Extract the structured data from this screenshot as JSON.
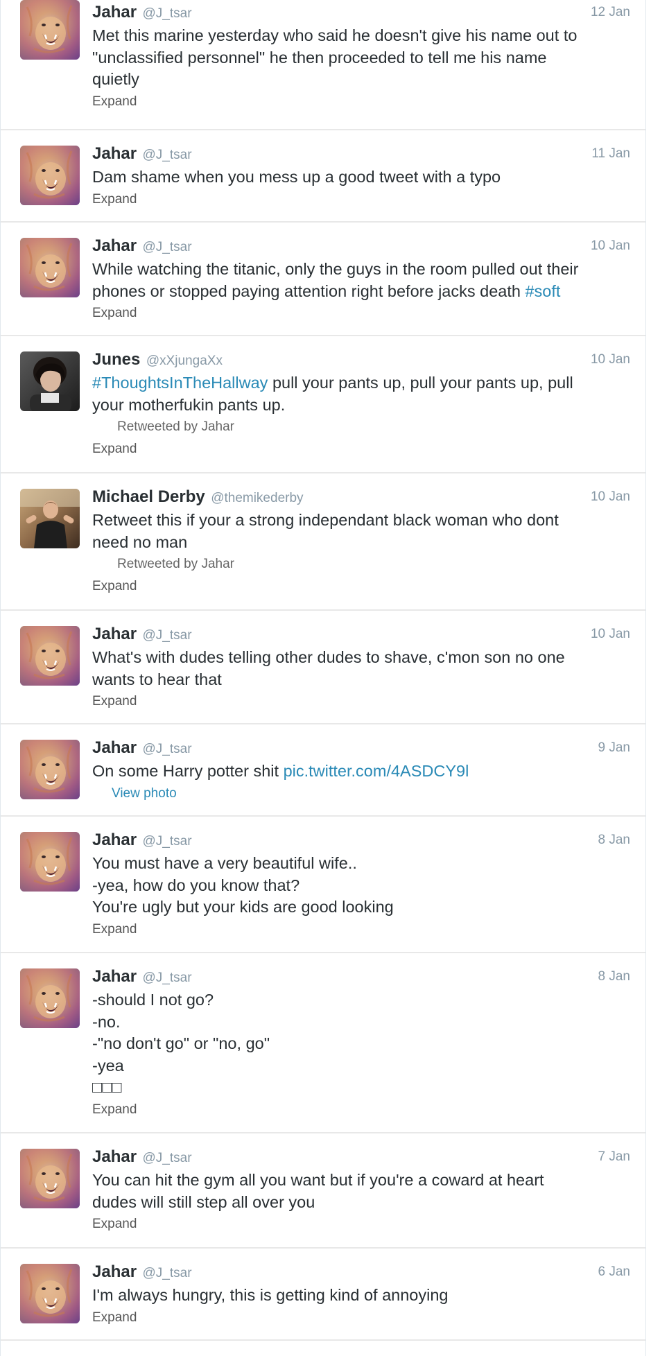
{
  "expand_label": "Expand",
  "tweets": [
    {
      "name": "Jahar",
      "handle": "@J_tsar",
      "date": "12 Jan",
      "lines": [
        "Met this marine yesterday who said he doesn't give his name out to",
        "\"unclassified personnel\" he then proceeded to tell me his name",
        "quietly"
      ]
    },
    {
      "name": "Jahar",
      "handle": "@J_tsar",
      "date": "11 Jan",
      "lines": [
        "Dam shame when you mess up a good tweet with a typo"
      ]
    },
    {
      "name": "Jahar",
      "handle": "@J_tsar",
      "date": "10 Jan",
      "lines": [
        "While watching the titanic, only the guys in the room pulled out their",
        "phones or stopped paying attention right before jacks death "
      ],
      "hashtag": "#soft"
    },
    {
      "name": "Junes",
      "handle": "@xXjungaXx",
      "date": "10 Jan",
      "hashtag": "#ThoughtsInTheHallway",
      "lines": [
        " pull your pants up, pull your pants up, pull",
        "your motherfukin pants up."
      ],
      "retweeted_by": "Retweeted by Jahar"
    },
    {
      "name": "Michael Derby",
      "handle": "@themikederby",
      "date": "10 Jan",
      "lines": [
        "Retweet this if your a strong independant black woman who dont",
        "need no man"
      ],
      "retweeted_by": "Retweeted by Jahar"
    },
    {
      "name": "Jahar",
      "handle": "@J_tsar",
      "date": "10 Jan",
      "lines": [
        "What's with dudes telling other dudes to shave, c'mon son no one",
        "wants to hear that"
      ]
    },
    {
      "name": "Jahar",
      "handle": "@J_tsar",
      "date": "9 Jan",
      "lines": [
        "On some Harry potter shit "
      ],
      "link": "pic.twitter.com/4ASDCY9l",
      "view_photo": "View photo"
    },
    {
      "name": "Jahar",
      "handle": "@J_tsar",
      "date": "8 Jan",
      "lines": [
        "You must have a very beautiful wife..",
        "-yea, how do you know that?",
        "You're ugly but your kids are good looking"
      ]
    },
    {
      "name": "Jahar",
      "handle": "@J_tsar",
      "date": "8 Jan",
      "lines": [
        "-should I not go?",
        "-no.",
        "-\"no don't go\" or \"no, go\"",
        "-yea",
        "□□□"
      ]
    },
    {
      "name": "Jahar",
      "handle": "@J_tsar",
      "date": "7 Jan",
      "lines": [
        "You can hit the gym all you want but if you're a coward at heart",
        "dudes will still step all over you"
      ]
    },
    {
      "name": "Jahar",
      "handle": "@J_tsar",
      "date": "6 Jan",
      "lines": [
        "I'm always hungry, this is getting kind of annoying"
      ]
    }
  ]
}
